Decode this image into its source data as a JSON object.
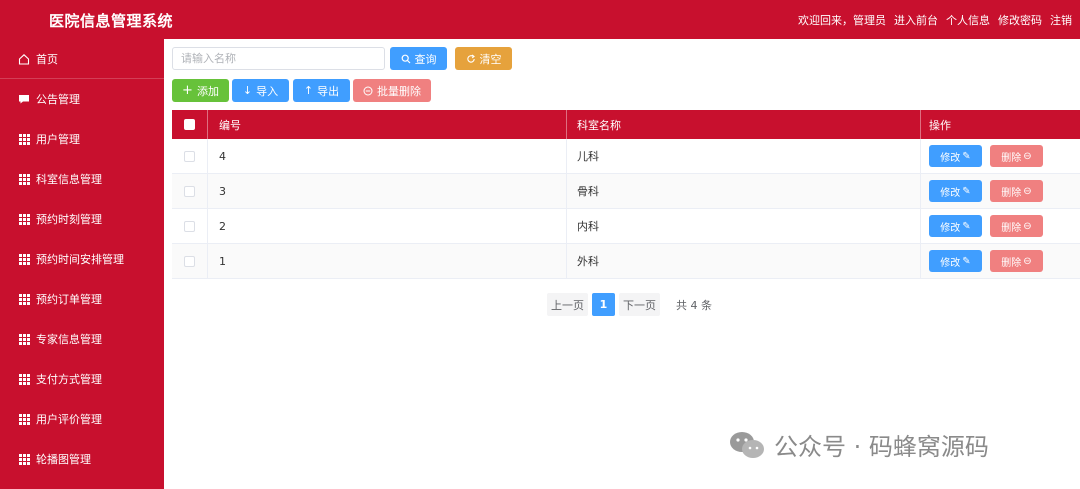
{
  "header": {
    "title": "医院信息管理系统",
    "welcome": "欢迎回来，管理员",
    "links": [
      "进入前台",
      "个人信息",
      "修改密码",
      "注销"
    ]
  },
  "sidebar": {
    "items": [
      {
        "label": "首页",
        "icon": "home-icon"
      },
      {
        "label": "公告管理",
        "icon": "chat-icon"
      },
      {
        "label": "用户管理",
        "icon": "grid-icon"
      },
      {
        "label": "科室信息管理",
        "icon": "grid-icon"
      },
      {
        "label": "预约时刻管理",
        "icon": "grid-icon"
      },
      {
        "label": "预约时间安排管理",
        "icon": "grid-icon"
      },
      {
        "label": "预约订单管理",
        "icon": "grid-icon"
      },
      {
        "label": "专家信息管理",
        "icon": "grid-icon"
      },
      {
        "label": "支付方式管理",
        "icon": "grid-icon"
      },
      {
        "label": "用户评价管理",
        "icon": "grid-icon"
      },
      {
        "label": "轮播图管理",
        "icon": "grid-icon"
      }
    ]
  },
  "search": {
    "placeholder": "请输入名称",
    "value": "",
    "query_label": "查询",
    "clear_label": "清空"
  },
  "toolbar": {
    "add_label": "添加",
    "import_label": "导入",
    "export_label": "导出",
    "batch_delete_label": "批量删除"
  },
  "table": {
    "headers": {
      "id": "编号",
      "name": "科室名称",
      "op": "操作"
    },
    "rows": [
      {
        "id": "4",
        "name": "儿科"
      },
      {
        "id": "3",
        "name": "骨科"
      },
      {
        "id": "2",
        "name": "内科"
      },
      {
        "id": "1",
        "name": "外科"
      }
    ],
    "edit_label": "修改",
    "delete_label": "删除"
  },
  "pagination": {
    "prev_label": "上一页",
    "current": "1",
    "next_label": "下一页",
    "total_label": "共 4 条"
  },
  "watermark": {
    "text": "公众号 · 码蜂窝源码"
  },
  "colors": {
    "brand": "#c8102e",
    "primary": "#409eff",
    "warning": "#e6a23c",
    "success": "#67c23a",
    "danger": "#f56c6c"
  }
}
